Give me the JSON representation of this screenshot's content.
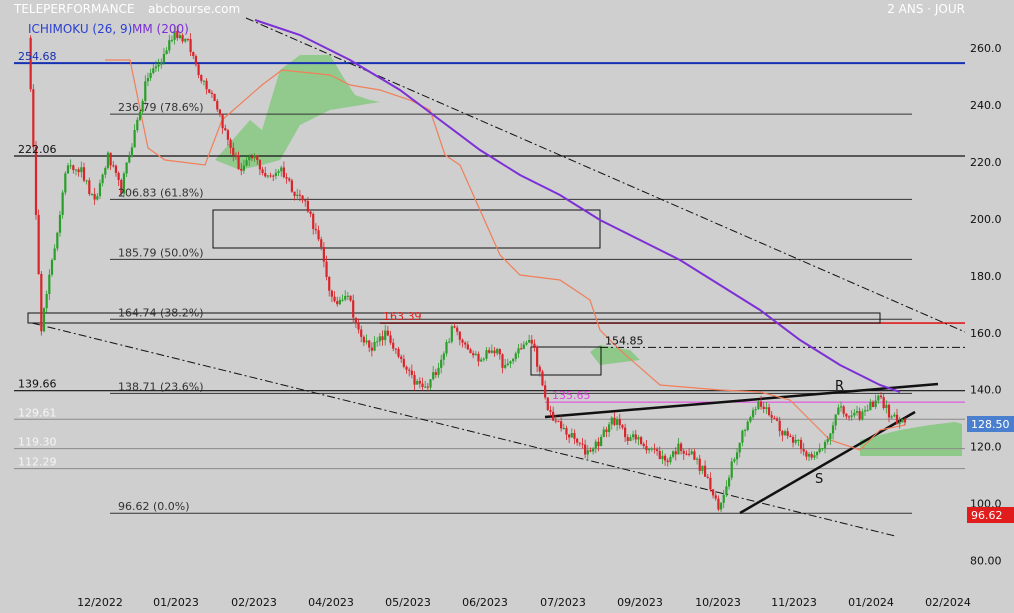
{
  "header": {
    "title": "TELEPERFORMANCE",
    "source": "abcbourse.com",
    "period": "2 ANS · JOUR",
    "indicators": [
      "ICHIMOKU (26, 9)",
      "MM (200)"
    ]
  },
  "colors": {
    "background": "#cfcfcf",
    "up_candle": "#2a9e2a",
    "down_candle": "#d8242a",
    "mm200": "#7d2fd6",
    "kijun": "#f07f5a",
    "cloud": "#8ec98a",
    "blue_level": "#1530b0",
    "red_level": "#e11c1c",
    "magenta_level": "#e040e0",
    "last_price_bg": "#4a7fd0",
    "low_bg": "#e01c1c"
  },
  "labels": {
    "last_price": "128.50",
    "low_price": "96.62",
    "pattern_r": "R",
    "pattern_s": "S"
  },
  "chart_data": {
    "type": "candlestick",
    "title": "TELEPERFORMANCE",
    "y_axis": {
      "min": 80,
      "max": 265,
      "ticks": [
        "260.0",
        "240.0",
        "220.0",
        "200.0",
        "180.0",
        "160.0",
        "140.0",
        "120.0",
        "100.0",
        "80.00"
      ]
    },
    "x_axis": {
      "ticks": [
        "12/2022",
        "01/2023",
        "02/2023",
        "04/2023",
        "05/2023",
        "06/2023",
        "07/2023",
        "09/2023",
        "10/2023",
        "11/2023",
        "01/2024",
        "02/2024"
      ]
    },
    "levels": [
      {
        "label": "254.68",
        "value": 254.68,
        "style": "blue"
      },
      {
        "label": "236.79  (78.6%)",
        "value": 236.79,
        "style": "fib"
      },
      {
        "label": "222.06",
        "value": 222.06,
        "style": "black"
      },
      {
        "label": "206.83  (61.8%)",
        "value": 206.83,
        "style": "fib"
      },
      {
        "label": "185.79  (50.0%)",
        "value": 185.79,
        "style": "fib"
      },
      {
        "label": "164.74  (38.2%)",
        "value": 164.74,
        "style": "fib"
      },
      {
        "label": "163.39",
        "value": 163.39,
        "style": "red"
      },
      {
        "label": "154.85",
        "value": 154.85,
        "style": "dashdot"
      },
      {
        "label": "139.66",
        "value": 139.66,
        "style": "black"
      },
      {
        "label": "138.71  (23.6%)",
        "value": 138.71,
        "style": "fib"
      },
      {
        "label": "135.65",
        "value": 135.65,
        "style": "magenta"
      },
      {
        "label": "129.61",
        "value": 129.61,
        "style": "grey"
      },
      {
        "label": "119.30",
        "value": 119.3,
        "style": "grey"
      },
      {
        "label": "112.29",
        "value": 112.29,
        "style": "grey"
      },
      {
        "label": "96.62  (0.0%)",
        "value": 96.62,
        "style": "fib"
      }
    ],
    "last_price": 128.5,
    "low": 96.62,
    "close_path": [
      {
        "date": "2022-11",
        "close": 265
      },
      {
        "date": "2022-11",
        "close": 162
      },
      {
        "date": "2022-11",
        "close": 190
      },
      {
        "date": "2022-11",
        "close": 220
      },
      {
        "date": "2022-12",
        "close": 217
      },
      {
        "date": "2022-12",
        "close": 205
      },
      {
        "date": "2022-12",
        "close": 222
      },
      {
        "date": "2022-12",
        "close": 210
      },
      {
        "date": "2023-01",
        "close": 230
      },
      {
        "date": "2023-01",
        "close": 250
      },
      {
        "date": "2023-01",
        "close": 255
      },
      {
        "date": "2023-01",
        "close": 266
      },
      {
        "date": "2023-02",
        "close": 262
      },
      {
        "date": "2023-02",
        "close": 250
      },
      {
        "date": "2023-02",
        "close": 243
      },
      {
        "date": "2023-02",
        "close": 228
      },
      {
        "date": "2023-03",
        "close": 217
      },
      {
        "date": "2023-03",
        "close": 222
      },
      {
        "date": "2023-03",
        "close": 214
      },
      {
        "date": "2023-03",
        "close": 218
      },
      {
        "date": "2023-04",
        "close": 210
      },
      {
        "date": "2023-04",
        "close": 205
      },
      {
        "date": "2023-04",
        "close": 190
      },
      {
        "date": "2023-04",
        "close": 169
      },
      {
        "date": "2023-04",
        "close": 175
      },
      {
        "date": "2023-05",
        "close": 158
      },
      {
        "date": "2023-05",
        "close": 155
      },
      {
        "date": "2023-05",
        "close": 160
      },
      {
        "date": "2023-05",
        "close": 150
      },
      {
        "date": "2023-05",
        "close": 143
      },
      {
        "date": "2023-06",
        "close": 140
      },
      {
        "date": "2023-06",
        "close": 150
      },
      {
        "date": "2023-06",
        "close": 162
      },
      {
        "date": "2023-06",
        "close": 156
      },
      {
        "date": "2023-06",
        "close": 150
      },
      {
        "date": "2023-06",
        "close": 155
      },
      {
        "date": "2023-07",
        "close": 147
      },
      {
        "date": "2023-07",
        "close": 155
      },
      {
        "date": "2023-07",
        "close": 157
      },
      {
        "date": "2023-07",
        "close": 134
      },
      {
        "date": "2023-07",
        "close": 127
      },
      {
        "date": "2023-08",
        "close": 123
      },
      {
        "date": "2023-08",
        "close": 118
      },
      {
        "date": "2023-08",
        "close": 122
      },
      {
        "date": "2023-09",
        "close": 130
      },
      {
        "date": "2023-09",
        "close": 124
      },
      {
        "date": "2023-09",
        "close": 122
      },
      {
        "date": "2023-09",
        "close": 119
      },
      {
        "date": "2023-10",
        "close": 115
      },
      {
        "date": "2023-10",
        "close": 120
      },
      {
        "date": "2023-10",
        "close": 117
      },
      {
        "date": "2023-10",
        "close": 110
      },
      {
        "date": "2023-10",
        "close": 97
      },
      {
        "date": "2023-11",
        "close": 115
      },
      {
        "date": "2023-11",
        "close": 128
      },
      {
        "date": "2023-11",
        "close": 135
      },
      {
        "date": "2023-11",
        "close": 131
      },
      {
        "date": "2023-11",
        "close": 124
      },
      {
        "date": "2023-12",
        "close": 122
      },
      {
        "date": "2023-12",
        "close": 115
      },
      {
        "date": "2023-12",
        "close": 122
      },
      {
        "date": "2023-12",
        "close": 133
      },
      {
        "date": "2024-01",
        "close": 130
      },
      {
        "date": "2024-01",
        "close": 132
      },
      {
        "date": "2024-01",
        "close": 138
      },
      {
        "date": "2024-01",
        "close": 130
      },
      {
        "date": "2024-01",
        "close": 128.5
      }
    ]
  }
}
